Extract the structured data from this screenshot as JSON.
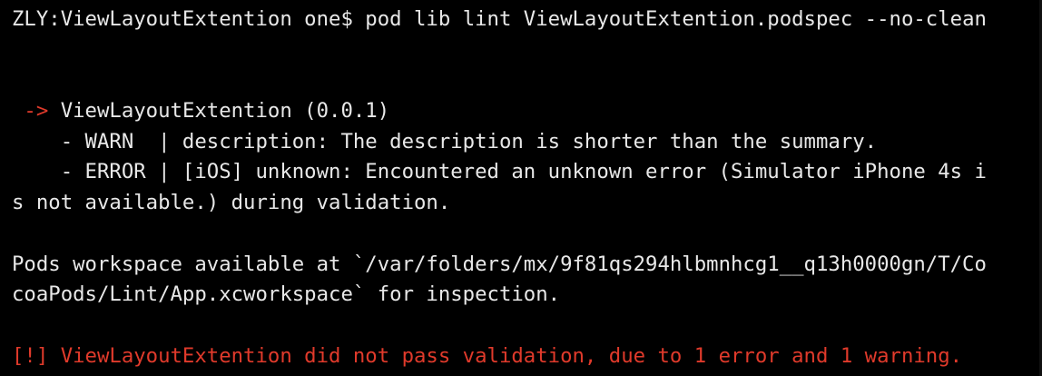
{
  "terminal": {
    "prompt": "ZLY:ViewLayoutExtention one$ ",
    "command": "pod lib lint ViewLayoutExtention.podspec --no-clean",
    "spec_arrow": " -> ",
    "spec_name": "ViewLayoutExtention (0.0.1)",
    "warn_line": "    - WARN  | description: The description is shorter than the summary.",
    "error_line_1": "    - ERROR | [iOS] unknown: Encountered an unknown error (Simulator iPhone 4s i",
    "error_line_2": "s not available.) during validation.",
    "workspace_line_1": "Pods workspace available at `/var/folders/mx/9f81qs294hlbmnhcg1__q13h0000gn/T/Co",
    "workspace_line_2": "coaPods/Lint/App.xcworkspace` for inspection.",
    "result_line": "[!] ViewLayoutExtention did not pass validation, due to 1 error and 1 warning."
  },
  "colors": {
    "background": "#000000",
    "text": "#e8e8e8",
    "error": "#e03a2b"
  }
}
